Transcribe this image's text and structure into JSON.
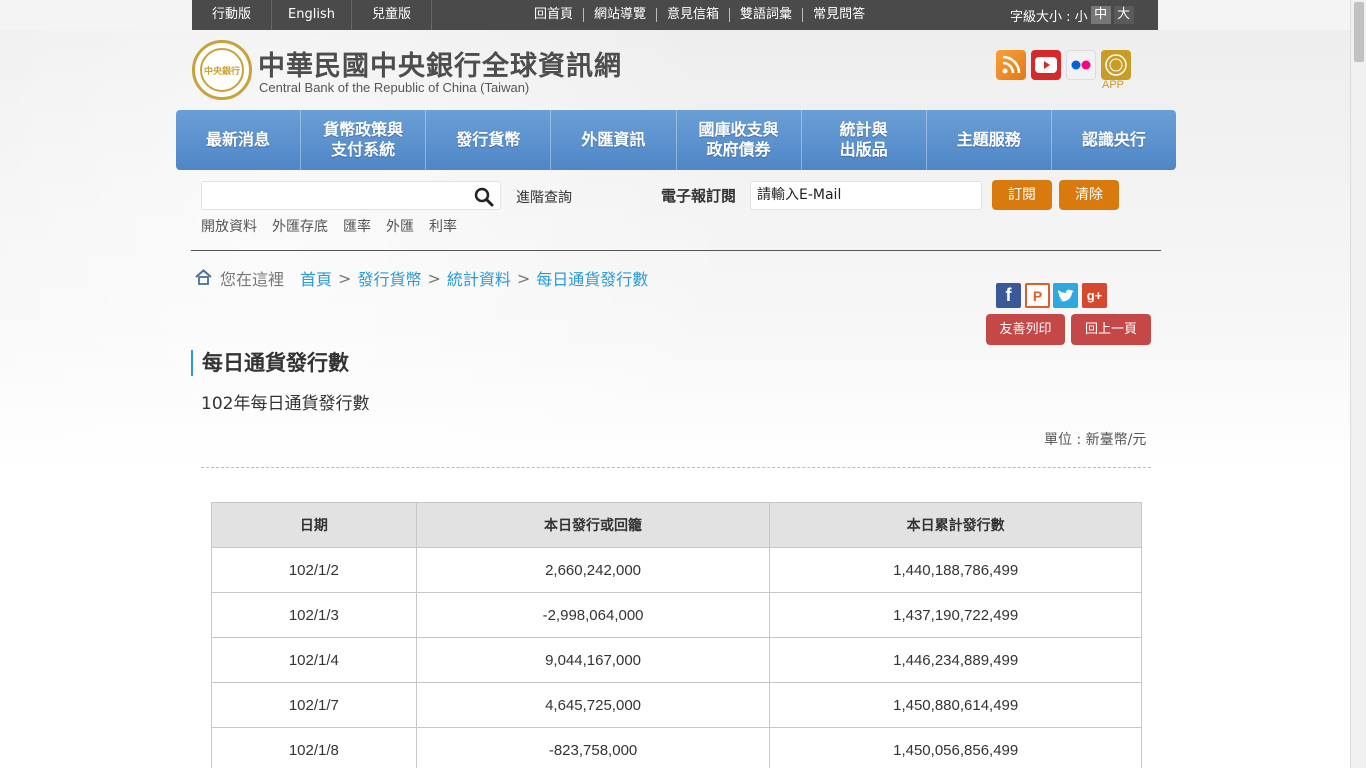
{
  "topbar": {
    "versions": [
      "行動版",
      "English",
      "兒童版"
    ],
    "links": [
      "回首頁",
      "網站導覽",
      "意見信箱",
      "雙語詞彙",
      "常見問答"
    ],
    "fontsize_label": "字級大小 : 小",
    "fontsize_options": [
      "中",
      "大"
    ]
  },
  "header": {
    "title": "中華民國中央銀行全球資訊網",
    "subtitle": "Central Bank of the Republic of China (Taiwan)",
    "seal_text": "中央銀行",
    "app_label": "APP"
  },
  "nav": [
    "最新消息",
    "貨幣政策與\n支付系統",
    "發行貨幣",
    "外匯資訊",
    "國庫收支與\n政府債券",
    "統計與\n出版品",
    "主題服務",
    "認識央行"
  ],
  "search": {
    "placeholder": "",
    "advanced": "進階查詢",
    "quick_links": [
      "開放資料",
      "外匯存底",
      "匯率",
      "外匯",
      "利率"
    ]
  },
  "epaper": {
    "label": "電子報訂閱",
    "email_value": "請輸入E-Mail",
    "subscribe": "訂閱",
    "clear": "清除"
  },
  "breadcrumb": {
    "here": "您在這裡",
    "items": [
      "首頁",
      "發行貨幣",
      "統計資料",
      "每日通貨發行數"
    ]
  },
  "actions": {
    "print": "友善列印",
    "back": "回上一頁"
  },
  "content": {
    "title": "每日通貨發行數",
    "subtitle": "102年每日通貨發行數",
    "unit": "單位 : 新臺幣/元",
    "columns": [
      "日期",
      "本日發行或回籠",
      "本日累計發行數"
    ],
    "rows": [
      [
        "102/1/2",
        "2,660,242,000",
        "1,440,188,786,499"
      ],
      [
        "102/1/3",
        "-2,998,064,000",
        "1,437,190,722,499"
      ],
      [
        "102/1/4",
        "9,044,167,000",
        "1,446,234,889,499"
      ],
      [
        "102/1/7",
        "4,645,725,000",
        "1,450,880,614,499"
      ],
      [
        "102/1/8",
        "-823,758,000",
        "1,450,056,856,499"
      ]
    ]
  },
  "colors": {
    "nav": "#5a90cc",
    "orange_button": "#d97a0f",
    "red_button": "#c44848",
    "link": "#2a9ad5",
    "gold": "#c8a23a"
  }
}
